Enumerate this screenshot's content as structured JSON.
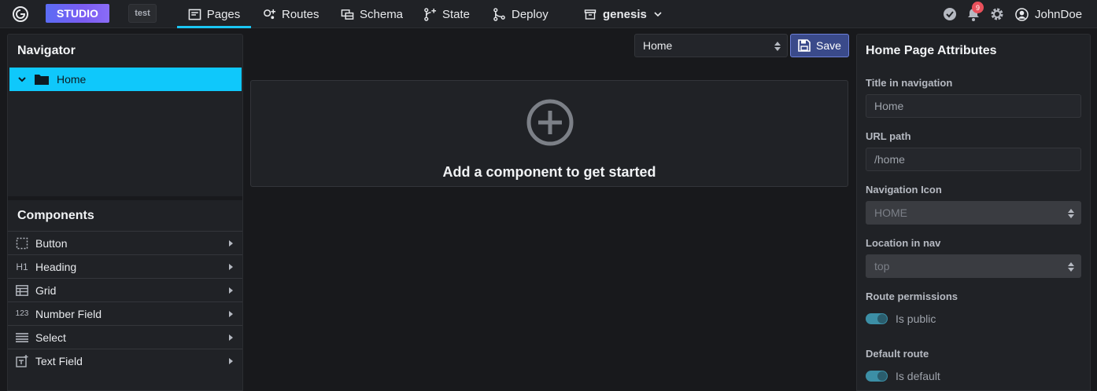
{
  "topbar": {
    "studio_label": "STUDIO",
    "env_label": "test",
    "tabs": [
      {
        "label": "Pages",
        "icon": "pages-icon",
        "active": true
      },
      {
        "label": "Routes",
        "icon": "routes-icon",
        "active": false
      },
      {
        "label": "Schema",
        "icon": "schema-icon",
        "active": false
      },
      {
        "label": "State",
        "icon": "state-icon",
        "active": false
      },
      {
        "label": "Deploy",
        "icon": "deploy-icon",
        "active": false
      }
    ],
    "project_name": "genesis",
    "notification_count": "9",
    "username": "JohnDoe"
  },
  "navigator": {
    "title": "Navigator",
    "items": [
      {
        "label": "Home",
        "icon": "folder-icon",
        "expanded": true
      }
    ]
  },
  "components": {
    "title": "Components",
    "items": [
      {
        "label": "Button",
        "icon": "button-icon"
      },
      {
        "label": "Heading",
        "icon": "heading-icon",
        "glyph": "H1"
      },
      {
        "label": "Grid",
        "icon": "grid-icon"
      },
      {
        "label": "Number Field",
        "icon": "number-field-icon",
        "glyph": "123"
      },
      {
        "label": "Select",
        "icon": "select-icon"
      },
      {
        "label": "Text Field",
        "icon": "text-field-icon"
      }
    ]
  },
  "editor": {
    "page_select_value": "Home",
    "save_label": "Save",
    "empty_message": "Add a component to get started"
  },
  "attributes": {
    "title": "Home Page Attributes",
    "title_in_nav_label": "Title in navigation",
    "title_in_nav_placeholder": "Home",
    "url_path_label": "URL path",
    "url_path_placeholder": "/home",
    "nav_icon_label": "Navigation Icon",
    "nav_icon_value": "HOME",
    "location_label": "Location in nav",
    "location_value": "top",
    "route_permissions_label": "Route permissions",
    "is_public_label": "Is public",
    "default_route_label": "Default route",
    "is_default_label": "Is default"
  },
  "colors": {
    "accent": "#0fc8fb",
    "studio_gradient_start": "#5b6cf5",
    "save_button": "#3a4a8a",
    "notification_badge": "#e8505b",
    "toggle_on": "#3c8fa6"
  }
}
